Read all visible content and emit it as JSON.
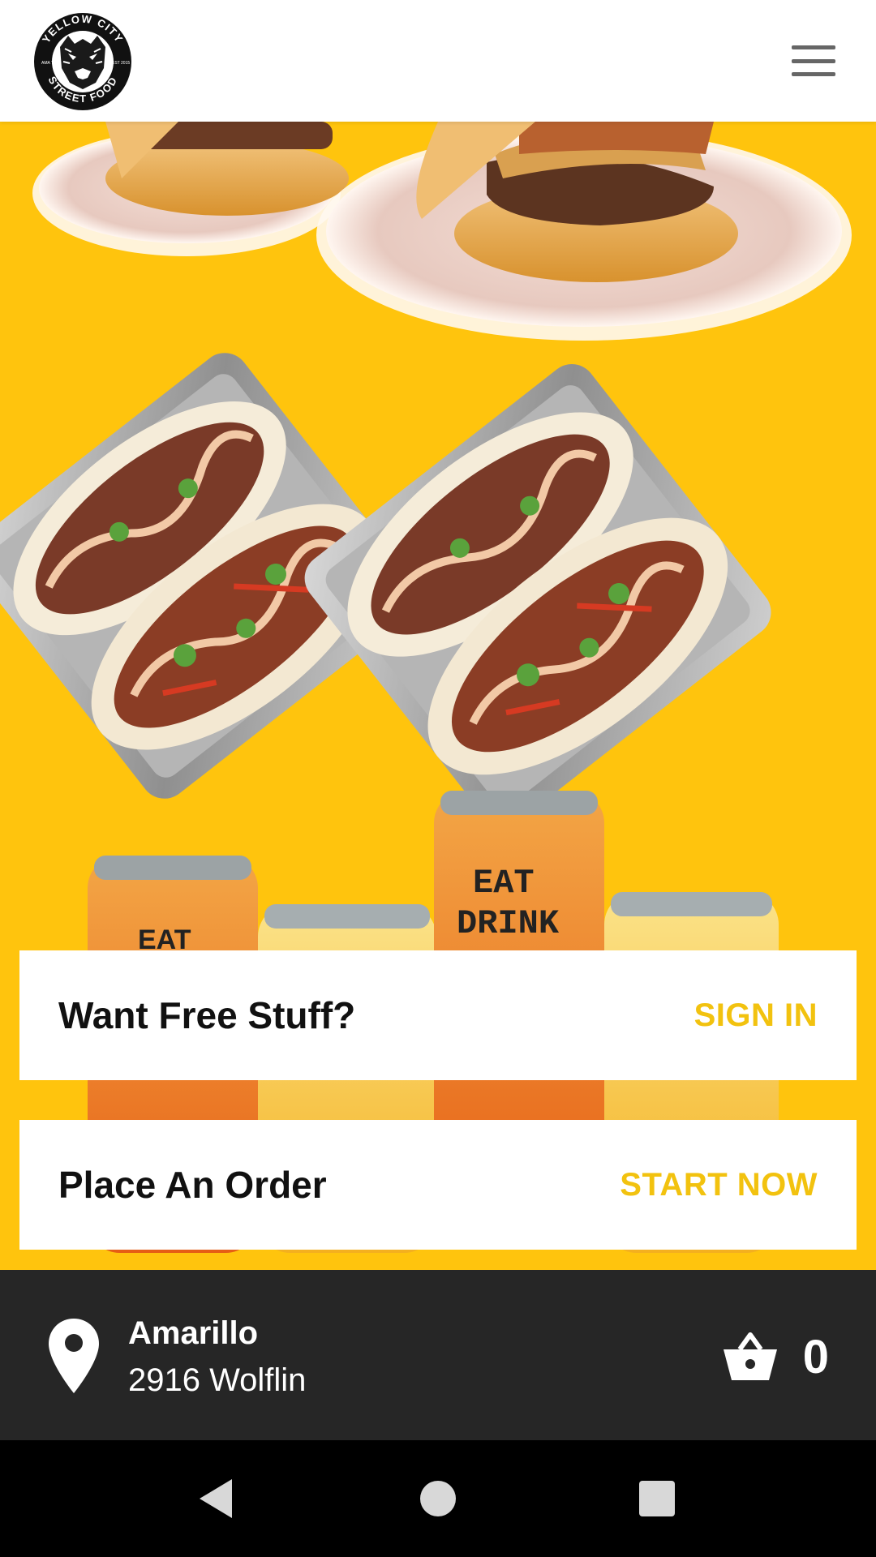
{
  "header": {
    "logo_text_top": "YELLOW CITY",
    "logo_text_bottom": "STREET FOOD",
    "logo_left": "AMA TX",
    "logo_right": "EST 2015",
    "menu_icon": "hamburger-menu-icon"
  },
  "hero": {
    "can_text_line1": "EAT",
    "can_text_line2": "DRINK",
    "can_text_partial": "EAT"
  },
  "cards": {
    "signin": {
      "title": "Want Free Stuff?",
      "action": "SIGN IN"
    },
    "order": {
      "title": "Place An Order",
      "action": "START NOW"
    }
  },
  "location": {
    "icon": "map-pin-icon",
    "city": "Amarillo",
    "street": "2916 Wolflin"
  },
  "cart": {
    "icon": "basket-icon",
    "count": "0"
  },
  "navbar": {
    "back_icon": "back-triangle-icon",
    "home_icon": "home-circle-icon",
    "recents_icon": "recents-square-icon"
  },
  "colors": {
    "brand_yellow": "#ffc40d",
    "accent_text": "#f2c20f",
    "dark_bar": "#262626",
    "nav_bg": "#000000"
  }
}
